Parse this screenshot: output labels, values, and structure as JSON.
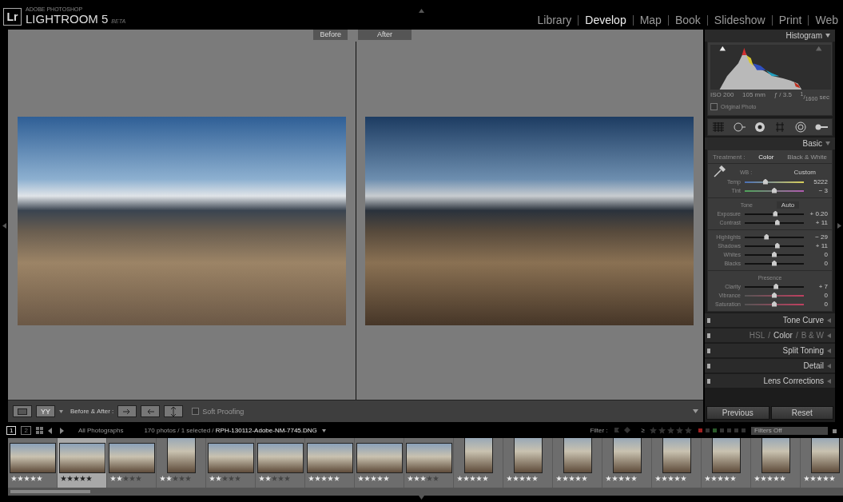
{
  "app": {
    "logo": "Lr",
    "vendor": "ADOBE PHOTOSHOP",
    "product": "LIGHTROOM 5",
    "badge": "BETA"
  },
  "modules": [
    {
      "label": "Library",
      "selected": false
    },
    {
      "label": "Develop",
      "selected": true
    },
    {
      "label": "Map",
      "selected": false
    },
    {
      "label": "Book",
      "selected": false
    },
    {
      "label": "Slideshow",
      "selected": false
    },
    {
      "label": "Print",
      "selected": false
    },
    {
      "label": "Web",
      "selected": false
    }
  ],
  "view": {
    "before_label": "Before",
    "after_label": "After"
  },
  "toolbar": {
    "view_mode": "YY",
    "before_after_label": "Before & After :",
    "soft_proofing": {
      "label": "Soft Proofing",
      "checked": false
    }
  },
  "right_panel": {
    "histogram": {
      "title": "Histogram",
      "iso": "ISO 200",
      "focal": "105 mm",
      "aperture": "ƒ / 3.5",
      "shutter": "$^{1}$/$_{1600}$ sec",
      "original_photo": {
        "label": "Original Photo",
        "checked": false
      }
    },
    "basic": {
      "title": "Basic",
      "treatment_label": "Treatment :",
      "treatments": [
        {
          "label": "Color",
          "selected": true
        },
        {
          "label": "Black & White",
          "selected": false
        }
      ],
      "wb_label": "WB :",
      "wb_value": "Custom",
      "wb_sliders": [
        {
          "label": "Temp",
          "kind": "temp",
          "level": 0.35,
          "reading": "5222"
        },
        {
          "label": "Tint",
          "kind": "tint",
          "level": 0.5,
          "reading": "− 3"
        }
      ],
      "tone_label": "Tone",
      "auto_label": "Auto",
      "tone_groups": [
        [
          {
            "label": "Exposure",
            "kind": "plain",
            "level": 0.52,
            "reading": "+ 0.20"
          },
          {
            "label": "Contrast",
            "kind": "plain",
            "level": 0.55,
            "reading": "+ 11"
          }
        ],
        [
          {
            "label": "Highlights",
            "kind": "plain",
            "level": 0.37,
            "reading": "− 29"
          },
          {
            "label": "Shadows",
            "kind": "plain",
            "level": 0.55,
            "reading": "+ 11"
          },
          {
            "label": "Whites",
            "kind": "plain",
            "level": 0.5,
            "reading": "0"
          },
          {
            "label": "Blacks",
            "kind": "plain",
            "level": 0.5,
            "reading": "0"
          }
        ]
      ],
      "presence_label": "Presence",
      "presence_sliders": [
        {
          "label": "Clarity",
          "kind": "plain",
          "level": 0.53,
          "reading": "+ 7"
        },
        {
          "label": "Vibrance",
          "kind": "color",
          "level": 0.5,
          "reading": "0"
        },
        {
          "label": "Saturation",
          "kind": "color",
          "level": 0.5,
          "reading": "0"
        }
      ]
    },
    "collapsed_panels": [
      {
        "kind": "single",
        "title": "Tone Curve"
      },
      {
        "kind": "tabs",
        "separators": [
          "/",
          "/"
        ],
        "tabs": [
          {
            "label": "HSL",
            "selected": false
          },
          {
            "label": "Color",
            "selected": true
          },
          {
            "label": "B & W",
            "selected": false
          }
        ]
      },
      {
        "kind": "single",
        "title": "Split Toning"
      },
      {
        "kind": "single",
        "title": "Detail"
      },
      {
        "kind": "single",
        "title": "Lens Corrections"
      }
    ],
    "buttons": [
      "Previous",
      "Reset"
    ]
  },
  "filmstrip": {
    "monitors": [
      {
        "label": "1",
        "selected": true
      },
      {
        "label": "2",
        "selected": false
      }
    ],
    "source": "All Photographs",
    "info": "170 photos / 1 selected / **RPH-130112-Adobe-NM-7745.DNG**",
    "filter_label": "Filter :",
    "filter_gte": "≥",
    "filter_preset": "Filters Off",
    "thumbnails": [
      {
        "kind": "landscape",
        "selected": false,
        "stars": 5
      },
      {
        "kind": "landscape",
        "selected": true,
        "stars": 5
      },
      {
        "kind": "landscape",
        "selected": false,
        "stars": 2
      },
      {
        "kind": "portrait",
        "selected": false,
        "stars": 2
      },
      {
        "kind": "landscape",
        "selected": false,
        "stars": 2
      },
      {
        "kind": "landscape",
        "selected": false,
        "stars": 2
      },
      {
        "kind": "landscape",
        "selected": false,
        "stars": 5
      },
      {
        "kind": "landscape",
        "selected": false,
        "stars": 5
      },
      {
        "kind": "landscape",
        "selected": false,
        "stars": 3
      },
      {
        "kind": "portrait",
        "selected": false,
        "stars": 5
      },
      {
        "kind": "portrait",
        "selected": false,
        "stars": 5
      },
      {
        "kind": "portrait",
        "selected": false,
        "stars": 5
      },
      {
        "kind": "portrait",
        "selected": false,
        "stars": 5
      },
      {
        "kind": "portrait",
        "selected": false,
        "stars": 5
      },
      {
        "kind": "portrait",
        "selected": false,
        "stars": 5
      },
      {
        "kind": "portrait",
        "selected": false,
        "stars": 5
      },
      {
        "kind": "portrait",
        "selected": false,
        "stars": 5
      }
    ]
  }
}
